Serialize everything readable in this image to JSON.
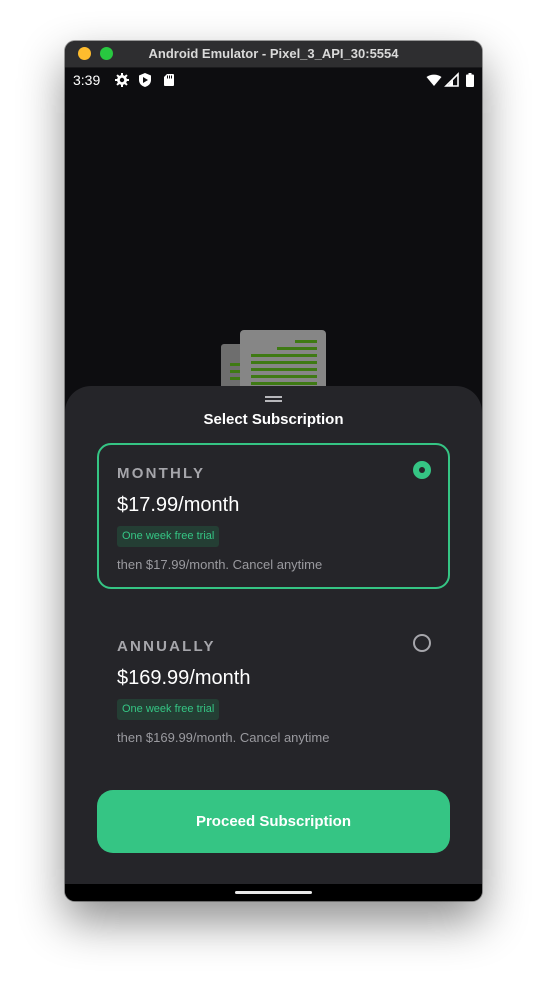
{
  "window": {
    "title": "Android Emulator - Pixel_3_API_30:5554"
  },
  "status_bar": {
    "time": "3:39"
  },
  "sheet": {
    "title": "Select Subscription",
    "plans": [
      {
        "name": "MONTHLY",
        "price": "$17.99/month",
        "badge": "One week free trial",
        "description": "then $17.99/month. Cancel anytime",
        "selected": true
      },
      {
        "name": "ANNUALLY",
        "price": "$169.99/month",
        "badge": "One week free trial",
        "description": "then $169.99/month. Cancel anytime",
        "selected": false
      }
    ],
    "cta_label": "Proceed Subscription"
  },
  "colors": {
    "accent": "#35c584",
    "sheet_background": "#252529",
    "screen_background": "#0d0d10",
    "badge_background": "#243e34"
  },
  "icons": [
    "gear-icon",
    "shield-icon",
    "sd-card-icon",
    "wifi-icon",
    "signal-icon",
    "battery-icon",
    "document-illustration"
  ]
}
